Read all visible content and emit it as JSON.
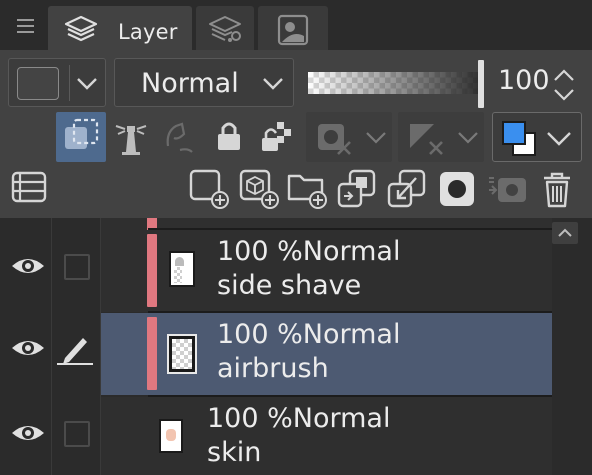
{
  "tabs": [
    {
      "label": "Layer",
      "icon": "layers-icon",
      "active": true
    },
    {
      "label": "",
      "icon": "layer-property-icon",
      "active": false
    },
    {
      "label": "",
      "icon": "navigator-icon",
      "active": false
    }
  ],
  "toolbar": {
    "blend_mode": "Normal",
    "opacity_value": "100",
    "opacity_level": 1.0,
    "colors": {
      "accent_selected": "#4e6a8e",
      "layer_color_bar": "#e07880",
      "main_color": "#3a8fef",
      "sub_color": "#ffffff"
    }
  },
  "layers": [
    {
      "opacity": "100 %",
      "blend": "Normal",
      "name": "side shave",
      "visible": true,
      "editing": false,
      "selected": false,
      "color_bar": true
    },
    {
      "opacity": "100 %",
      "blend": "Normal",
      "name": "airbrush",
      "visible": true,
      "editing": true,
      "selected": true,
      "color_bar": true
    },
    {
      "opacity": "100 %",
      "blend": "Normal",
      "name": "skin",
      "visible": true,
      "editing": false,
      "selected": false,
      "color_bar": false
    }
  ]
}
